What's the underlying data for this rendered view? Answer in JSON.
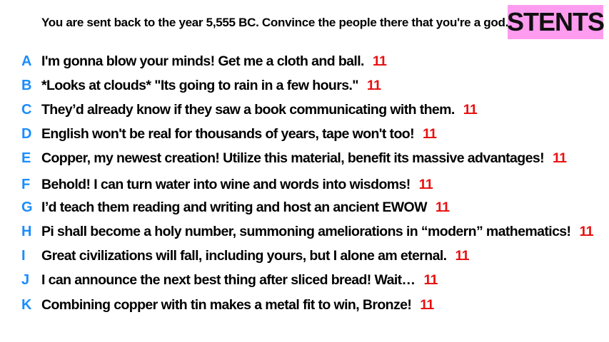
{
  "prompt": "You are sent back to the year 5,555 BC. Convince the people there that you're a god.",
  "badge": "STENTS",
  "colors": {
    "letter": "#1a8cff",
    "score": "#e81010",
    "badge_bg": "#ff9cf0"
  },
  "responses": [
    {
      "letter": "A",
      "text": "I'm gonna blow your minds! Get me a cloth and ball.",
      "score": "11"
    },
    {
      "letter": "B",
      "text": "*Looks at clouds* \"Its going to rain in a few hours.\"",
      "score": "11"
    },
    {
      "letter": "C",
      "text": "They’d already know if they saw a book communicating with them.",
      "score": "11"
    },
    {
      "letter": "D",
      "text": "English won't be real for thousands of years, tape won't too!",
      "score": "11"
    },
    {
      "letter": "E",
      "text": "Copper, my newest creation! Utilize this material, benefit its massive advantages!",
      "score": "11"
    },
    {
      "letter": "F",
      "text": "Behold! I can turn water into wine and words into wisdoms!",
      "score": "11"
    },
    {
      "letter": "G",
      "text": "I’d teach them reading and writing and host an ancient EWOW",
      "score": "11"
    },
    {
      "letter": "H",
      "text": "Pi shall become a holy number, summoning ameliorations in “modern” mathematics!",
      "score": "11"
    },
    {
      "letter": "I",
      "text": "Great civilizations will fall, including yours, but I alone am eternal.",
      "score": "11"
    },
    {
      "letter": "J",
      "text": "I can announce the next best thing after sliced bread! Wait…",
      "score": "11"
    },
    {
      "letter": "K",
      "text": "Combining copper with tin makes a metal fit to win, Bronze!",
      "score": "11"
    }
  ]
}
